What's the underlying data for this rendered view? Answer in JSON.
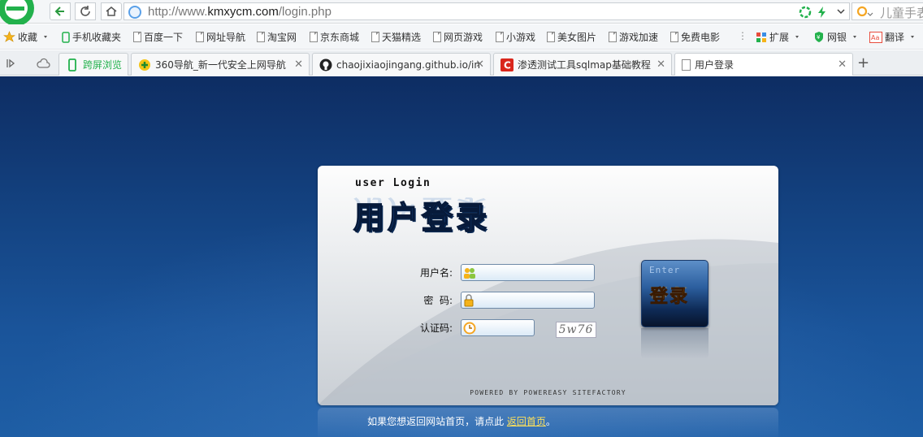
{
  "browser": {
    "url_prefix": "http://www.",
    "url_host": "kmxycm.com",
    "url_path": "/login.php",
    "search_placeholder": "儿童手表",
    "bookmarks": [
      {
        "label": "收藏",
        "icon": "star-icon"
      },
      {
        "label": "手机收藏夹",
        "icon": "phone-icon"
      },
      {
        "label": "百度一下",
        "icon": "page-icon"
      },
      {
        "label": "网址导航",
        "icon": "page-icon"
      },
      {
        "label": "淘宝网",
        "icon": "page-icon"
      },
      {
        "label": "京东商城",
        "icon": "page-icon"
      },
      {
        "label": "天猫精选",
        "icon": "page-icon"
      },
      {
        "label": "网页游戏",
        "icon": "page-icon"
      },
      {
        "label": "小游戏",
        "icon": "page-icon"
      },
      {
        "label": "美女图片",
        "icon": "page-icon"
      },
      {
        "label": "游戏加速",
        "icon": "page-icon"
      },
      {
        "label": "免费电影",
        "icon": "page-icon"
      },
      {
        "label": "扩展",
        "icon": "grid-icon"
      },
      {
        "label": "网银",
        "icon": "shield-icon"
      },
      {
        "label": "翻译",
        "icon": "translate-icon"
      }
    ],
    "tabs": [
      {
        "label": "跨屏浏览",
        "icon": "phone-icon"
      },
      {
        "label": "360导航_新一代安全上网导航",
        "icon": "360-icon"
      },
      {
        "label": "chaojixiaojingang.github.io/in",
        "icon": "github-icon"
      },
      {
        "label": "渗透测试工具sqlmap基础教程",
        "icon": "csdn-icon"
      },
      {
        "label": "用户登录",
        "icon": "page-icon",
        "active": true
      }
    ]
  },
  "login": {
    "subtitle": "user Login",
    "title": "用户登录",
    "username_label": "用户名:",
    "username_value": "",
    "password_label": "密  码:",
    "password_value": "",
    "code_label": "认证码:",
    "code_value": "",
    "captcha": "5w76",
    "enter_text": "Enter",
    "enter_label": "登录",
    "powered_by": "POWERED BY POWEREASY SITEFACTORY"
  },
  "footer": {
    "text": "如果您想返回网站首页，请点此",
    "link": "返回首页",
    "suffix": "。"
  },
  "colors": {
    "page_bg": "#13417f",
    "title_blue": "#1d5fb3",
    "enter_orange": "#f6a21a",
    "footer_link": "#ffe15a",
    "browser_green": "#22b14c"
  }
}
